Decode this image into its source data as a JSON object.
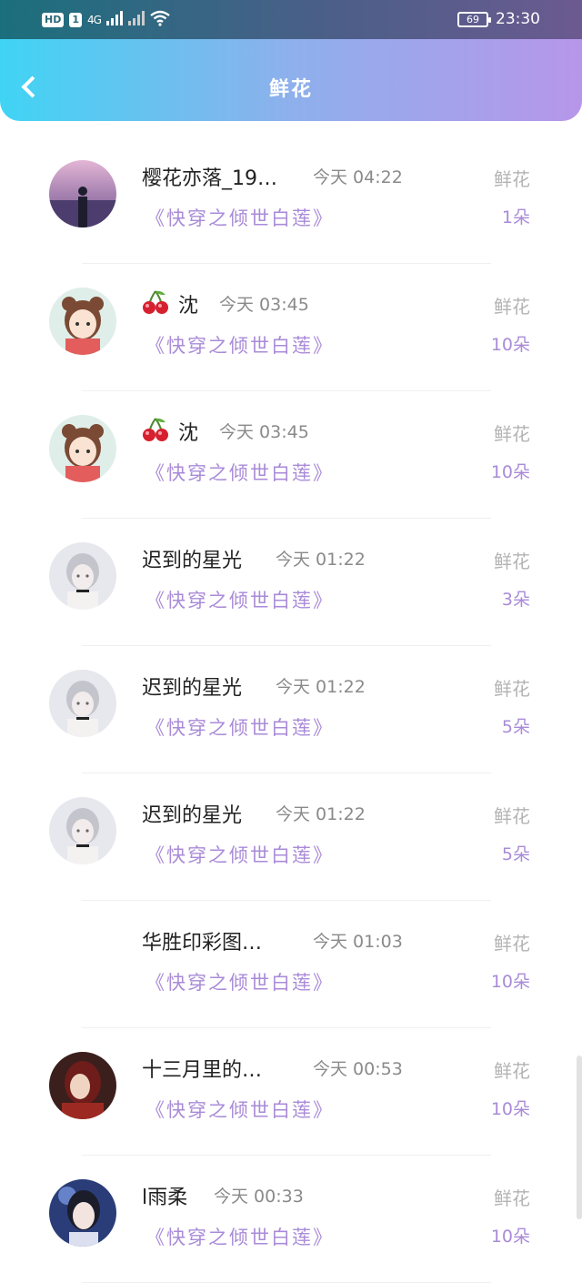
{
  "status": {
    "hd": "HD",
    "sim": "1",
    "net": "4G",
    "battery": "69",
    "time": "23:30"
  },
  "header": {
    "title": "鲜花"
  },
  "items": [
    {
      "name": "樱花亦落_19…",
      "time": "今天 04:22",
      "book": "《快穿之倾世白莲》",
      "gift": "鲜花",
      "count": "1朵",
      "avatar": "lake"
    },
    {
      "name": "沈",
      "time": "今天 03:45",
      "book": "《快穿之倾世白莲》",
      "gift": "鲜花",
      "count": "10朵",
      "avatar": "girl",
      "emoji": "🍒"
    },
    {
      "name": "沈",
      "time": "今天 03:45",
      "book": "《快穿之倾世白莲》",
      "gift": "鲜花",
      "count": "10朵",
      "avatar": "girl",
      "emoji": "🍒"
    },
    {
      "name": "迟到的星光",
      "time": "今天 01:22",
      "book": "《快穿之倾世白莲》",
      "gift": "鲜花",
      "count": "3朵",
      "avatar": "silver"
    },
    {
      "name": "迟到的星光",
      "time": "今天 01:22",
      "book": "《快穿之倾世白莲》",
      "gift": "鲜花",
      "count": "5朵",
      "avatar": "silver"
    },
    {
      "name": "迟到的星光",
      "time": "今天 01:22",
      "book": "《快穿之倾世白莲》",
      "gift": "鲜花",
      "count": "5朵",
      "avatar": "silver"
    },
    {
      "name": "华胜印彩图…",
      "time": "今天 01:03",
      "book": "《快穿之倾世白莲》",
      "gift": "鲜花",
      "count": "10朵",
      "avatar": "none"
    },
    {
      "name": "十三月里的…",
      "time": "今天 00:53",
      "book": "《快穿之倾世白莲》",
      "gift": "鲜花",
      "count": "10朵",
      "avatar": "red"
    },
    {
      "name": "l雨柔",
      "time": "今天 00:33",
      "book": "《快穿之倾世白莲》",
      "gift": "鲜花",
      "count": "10朵",
      "avatar": "blue"
    }
  ]
}
